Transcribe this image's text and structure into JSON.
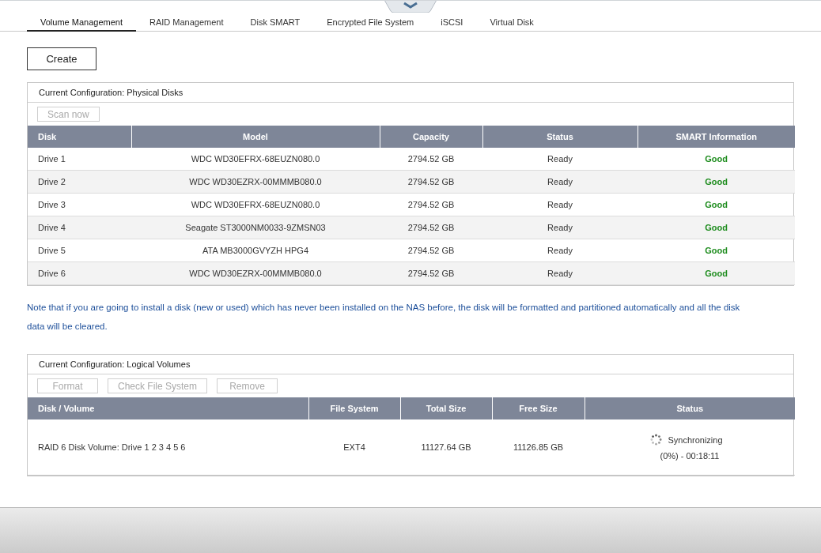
{
  "tabs": [
    {
      "label": "Volume Management",
      "selected": true
    },
    {
      "label": "RAID Management",
      "selected": false
    },
    {
      "label": "Disk SMART",
      "selected": false
    },
    {
      "label": "Encrypted File System",
      "selected": false
    },
    {
      "label": "iSCSI",
      "selected": false
    },
    {
      "label": "Virtual Disk",
      "selected": false
    }
  ],
  "create_button": {
    "label": "Create",
    "disabled": false
  },
  "physical_disks": {
    "title": "Current Configuration: Physical Disks",
    "buttons": [
      {
        "label": "Scan now",
        "disabled": true
      }
    ],
    "columns": [
      "Disk",
      "Model",
      "Capacity",
      "Status",
      "SMART Information"
    ],
    "rows": [
      {
        "disk": "Drive 1",
        "model": "WDC WD30EFRX-68EUZN080.0",
        "capacity": "2794.52 GB",
        "status": "Ready",
        "smart": "Good"
      },
      {
        "disk": "Drive 2",
        "model": "WDC WD30EZRX-00MMMB080.0",
        "capacity": "2794.52 GB",
        "status": "Ready",
        "smart": "Good"
      },
      {
        "disk": "Drive 3",
        "model": "WDC WD30EFRX-68EUZN080.0",
        "capacity": "2794.52 GB",
        "status": "Ready",
        "smart": "Good"
      },
      {
        "disk": "Drive 4",
        "model": "Seagate ST3000NM0033-9ZMSN03",
        "capacity": "2794.52 GB",
        "status": "Ready",
        "smart": "Good"
      },
      {
        "disk": "Drive 5",
        "model": "ATA MB3000GVYZH HPG4",
        "capacity": "2794.52 GB",
        "status": "Ready",
        "smart": "Good"
      },
      {
        "disk": "Drive 6",
        "model": "WDC WD30EZRX-00MMMB080.0",
        "capacity": "2794.52 GB",
        "status": "Ready",
        "smart": "Good"
      }
    ]
  },
  "note": "Note that if you are going to install a disk (new or used) which has never been installed on the NAS before, the disk will be formatted and partitioned automatically and all the disk data will be cleared.",
  "logical_volumes": {
    "title": "Current Configuration: Logical Volumes",
    "buttons": [
      {
        "label": "Format",
        "disabled": true
      },
      {
        "label": "Check File System",
        "disabled": true
      },
      {
        "label": "Remove",
        "disabled": true
      }
    ],
    "columns": [
      "Disk / Volume",
      "File System",
      "Total Size",
      "Free Size",
      "Status"
    ],
    "rows": [
      {
        "volume": "RAID 6 Disk Volume: Drive 1 2 3 4 5 6",
        "file_system": "EXT4",
        "total_size": "11127.64 GB",
        "free_size": "11126.85 GB",
        "status": "Synchronizing",
        "progress": "(0%) - 00:18:11",
        "syncing": true
      }
    ]
  }
}
